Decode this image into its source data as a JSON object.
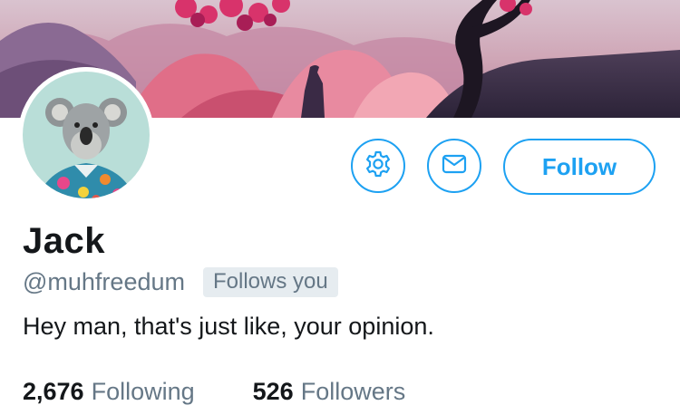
{
  "profile": {
    "display_name": "Jack",
    "handle": "@muhfreedum",
    "follows_you_label": "Follows you",
    "bio": "Hey man, that's just like, your opinion."
  },
  "actions": {
    "settings_icon": "gear-icon",
    "message_icon": "envelope-icon",
    "follow_label": "Follow"
  },
  "stats": {
    "following_count": "2,676",
    "following_label": "Following",
    "followers_count": "526",
    "followers_label": "Followers"
  },
  "colors": {
    "accent": "#1da1f2",
    "text_primary": "#14171a",
    "text_secondary": "#657786",
    "badge_bg": "#e6ecf0"
  }
}
